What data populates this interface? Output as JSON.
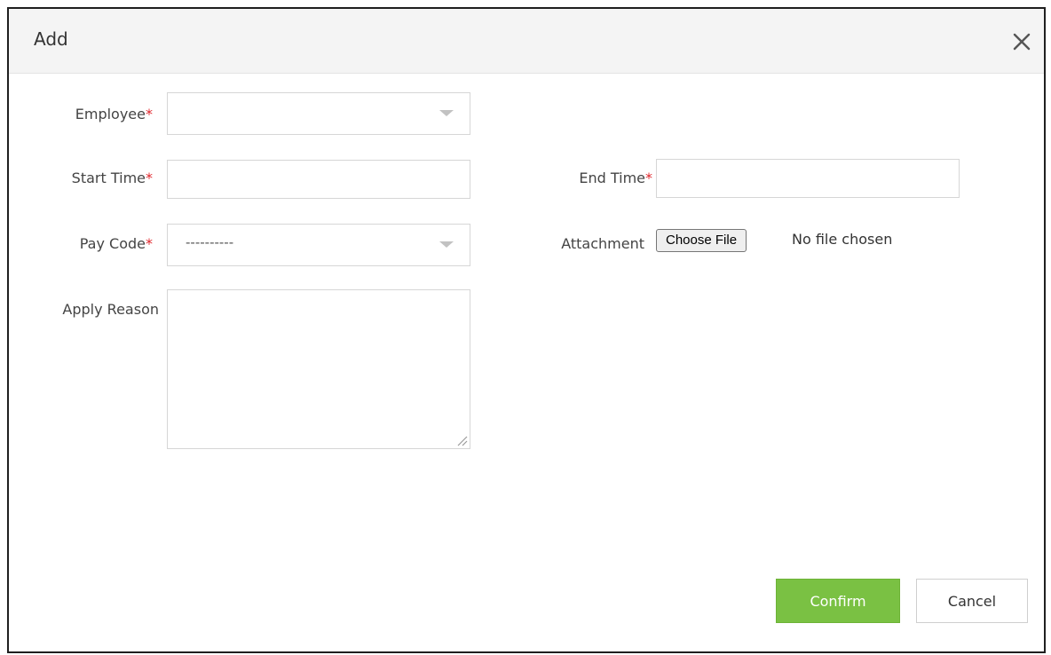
{
  "dialog": {
    "title": "Add",
    "close_icon": "close-icon"
  },
  "form": {
    "employee": {
      "label": "Employee",
      "required_mark": "*",
      "value": ""
    },
    "start_time": {
      "label": "Start Time",
      "required_mark": "*",
      "value": ""
    },
    "end_time": {
      "label": "End Time",
      "required_mark": "*",
      "value": ""
    },
    "pay_code": {
      "label": "Pay Code",
      "required_mark": "*",
      "value": "----------"
    },
    "attachment": {
      "label": "Attachment",
      "button_label": "Choose File",
      "status": "No file chosen"
    },
    "apply_reason": {
      "label": "Apply Reason",
      "value": ""
    }
  },
  "actions": {
    "confirm_label": "Confirm",
    "cancel_label": "Cancel"
  },
  "colors": {
    "confirm": "#7ac143",
    "required": "#e0252b",
    "header_bg": "#f4f4f4"
  }
}
